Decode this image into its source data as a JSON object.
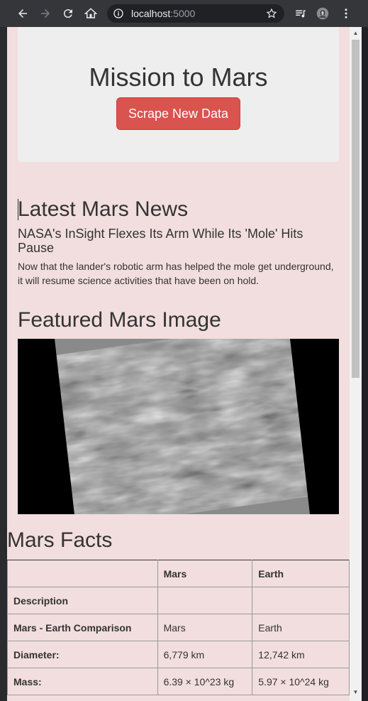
{
  "browser": {
    "url_host": "localhost",
    "url_port": ":5000"
  },
  "jumbotron": {
    "title": "Mission to Mars",
    "scrape_button": "Scrape New Data"
  },
  "news": {
    "section_title": "Latest Mars News",
    "headline": "NASA's InSight Flexes Its Arm While Its 'Mole' Hits Pause",
    "teaser": "Now that the lander's robotic arm has helped the mole get underground, it will resume science activities that have been on hold."
  },
  "featured": {
    "section_title": "Featured Mars Image"
  },
  "facts": {
    "section_title": "Mars Facts",
    "header": [
      "",
      "Mars",
      "Earth"
    ],
    "rows": [
      [
        "Description",
        "",
        ""
      ],
      [
        "Mars - Earth Comparison",
        "Mars",
        "Earth"
      ],
      [
        "Diameter:",
        "6,779 km",
        "12,742 km"
      ],
      [
        "Mass:",
        "6.39 × 10^23 kg",
        "5.97 × 10^24 kg"
      ]
    ]
  },
  "colors": {
    "page_bg": "#f2dede",
    "jumbotron_bg": "#eeeeee",
    "button_danger": "#d9534f",
    "chrome_bg": "#35363a"
  }
}
